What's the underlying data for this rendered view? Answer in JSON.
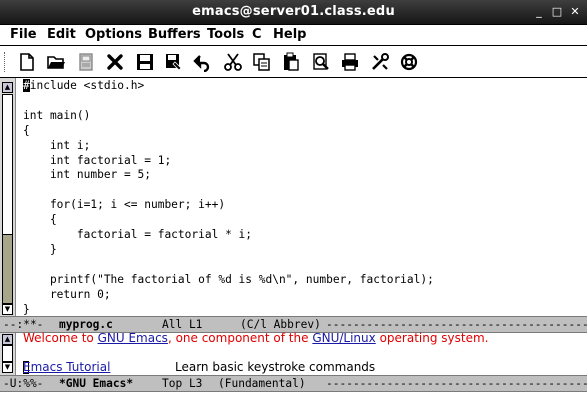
{
  "window": {
    "title": "emacs@server01.class.edu",
    "minimize": "_",
    "maximize": "□",
    "close": "✕"
  },
  "menu": [
    "File",
    "Edit",
    "Options",
    "Buffers",
    "Tools",
    "C",
    "Help"
  ],
  "toolbar_icons": [
    "new-file-icon",
    "open-folder-icon",
    "disk-icon",
    "close-x-icon",
    "save-icon",
    "save-as-icon",
    "undo-icon",
    "cut-icon",
    "copy-icon",
    "paste-icon",
    "search-icon",
    "print-icon",
    "preferences-icon",
    "help-icon"
  ],
  "editor": {
    "cursor_char": "#",
    "lines_after_cursor": [
      "include <stdio.h>",
      "",
      "int main()",
      "{",
      "    int i;",
      "    int factorial = 1;",
      "    int number = 5;",
      "",
      "    for(i=1; i <= number; i++)",
      "    {",
      "        factorial = factorial * i;",
      "    }",
      "",
      "    printf(\"The factorial of %d is %d\\n\", number, factorial);",
      "    return 0;",
      "}"
    ]
  },
  "modeline_top": {
    "status": "--:**-  ",
    "buffer": "myprog.c",
    "position": "All L1",
    "mode": "(C/l Abbrev)"
  },
  "modeline_bottom": {
    "status": "-U:%%-  ",
    "buffer": "*GNU Emacs*",
    "position": "Top L3",
    "mode": "(Fundamental)"
  },
  "welcome": {
    "prefix": "Welcome to ",
    "link1": "GNU Emacs",
    "middle": ", one component of the ",
    "link2": "GNU/Linux",
    "suffix": " operating system."
  },
  "tutorial": {
    "link": "Emacs Tutorial",
    "description": "Learn basic keystroke commands"
  },
  "colors": {
    "modeline_bg": "#bfbfbf",
    "welcome_red": "#e00000",
    "link_blue": "#1a1aa6",
    "scrollbar_track": "#a7a68a"
  }
}
